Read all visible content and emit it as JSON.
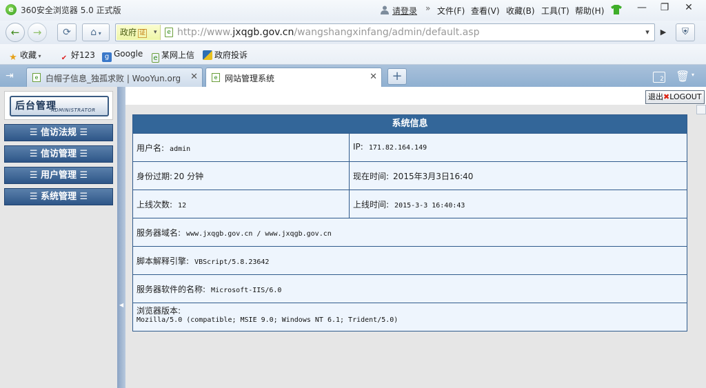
{
  "browser": {
    "app_title": "360安全浏览器 5.0 正式版",
    "login": "请登录",
    "menu_chevron": "»",
    "menus": [
      "文件(F)",
      "查看(V)",
      "收藏(B)",
      "工具(T)",
      "帮助(H)"
    ],
    "window_buttons": {
      "minimize": "—",
      "restore": "❐",
      "close": "✕"
    }
  },
  "addressbar": {
    "back": "←",
    "forward": "→",
    "refresh": "⟳",
    "home": "⌂",
    "gov_label": "政府",
    "gov_cert": "证",
    "url_prefix": "http://www.",
    "url_host": "jxqgb.gov.cn",
    "url_path": "/wangshangxinfang/admin/default.asp",
    "dropdown": "▾",
    "go": "▶",
    "shield": "⛨"
  },
  "bookmarks": [
    {
      "label": "收藏",
      "icon": "star-icon",
      "color": "#e6a21a"
    },
    {
      "label": "好123",
      "icon": "hao123-icon",
      "color": "#d22"
    },
    {
      "label": "Google",
      "icon": "google-icon",
      "color": "#3a78c9"
    },
    {
      "label": "某网上信",
      "icon": "page-icon",
      "color": "#2e8a14"
    },
    {
      "label": "政府投诉",
      "icon": "gov-icon",
      "color": "#2e6fb3"
    }
  ],
  "tabs": {
    "items": [
      {
        "label": "白帽子信息_独孤求败 | WooYun.org",
        "active": false
      },
      {
        "label": "网站管理系统",
        "active": true
      }
    ],
    "new_tab": "+",
    "count": "2"
  },
  "sidebar": {
    "logo_cn": "后台管理",
    "logo_en": "ADMINISTRATOR",
    "items": [
      {
        "label": "☰  信访法规  ☰"
      },
      {
        "label": "☰  信访管理  ☰"
      },
      {
        "label": "☰  用户管理  ☰"
      },
      {
        "label": "☰  系统管理  ☰"
      }
    ]
  },
  "main": {
    "logout_cn": "退出",
    "logout_en": "LOGOUT",
    "panel_title": "系统信息",
    "rows": {
      "username_label": "用户名:",
      "username_value": "admin",
      "ip_label": "IP:",
      "ip_value": "171.82.164.149",
      "expire_label": "身份过期:",
      "expire_value": "20 分钟",
      "now_label": "现在时间:",
      "now_value": "2015年3月3日16:40",
      "logins_label": "上线次数:",
      "logins_value": "12",
      "online_label": "上线时间:",
      "online_value": "2015-3-3 16:40:43",
      "domain_label": "服务器域名:",
      "domain_value": "www.jxqgb.gov.cn / www.jxqgb.gov.cn",
      "engine_label": "脚本解释引擎:",
      "engine_value": "VBScript/5.8.23642",
      "server_label": "服务器软件的名称:",
      "server_value": "Microsoft-IIS/6.0",
      "ua_label": "浏览器版本:",
      "ua_value": "Mozilla/5.0 (compatible; MSIE 9.0; Windows NT 6.1; Trident/5.0)"
    }
  }
}
